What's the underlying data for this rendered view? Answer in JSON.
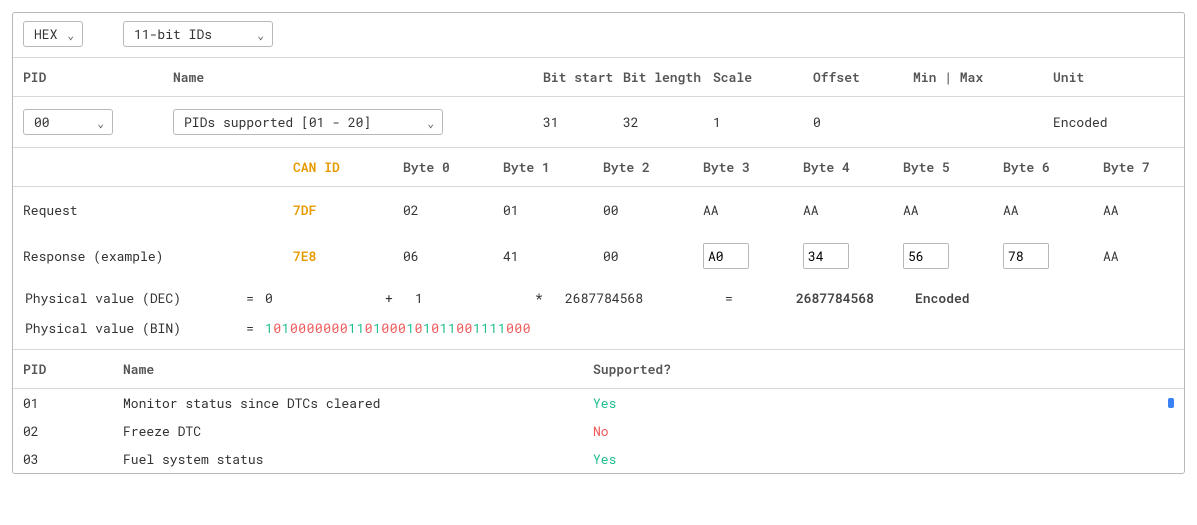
{
  "controls": {
    "format": "HEX",
    "id_width": "11-bit IDs"
  },
  "columns_top": {
    "pid": "PID",
    "name": "Name",
    "bit_start": "Bit start",
    "bit_length": "Bit length",
    "scale": "Scale",
    "offset": "Offset",
    "min_max": "Min | Max",
    "unit": "Unit"
  },
  "selected": {
    "pid": "00",
    "name": "PIDs supported [01 - 20]",
    "bit_start": "31",
    "bit_length": "32",
    "scale": "1",
    "offset": "0",
    "min_max": "",
    "unit": "Encoded"
  },
  "byte_headers": {
    "can_id": "CAN ID",
    "b0": "Byte 0",
    "b1": "Byte 1",
    "b2": "Byte 2",
    "b3": "Byte 3",
    "b4": "Byte 4",
    "b5": "Byte 5",
    "b6": "Byte 6",
    "b7": "Byte 7"
  },
  "request": {
    "label": "Request",
    "can_id": "7DF",
    "bytes": [
      "02",
      "01",
      "00",
      "AA",
      "AA",
      "AA",
      "AA",
      "AA"
    ]
  },
  "response": {
    "label": "Response (example)",
    "can_id": "7E8",
    "fixed": [
      "06",
      "41",
      "00"
    ],
    "inputs": [
      "A0",
      "34",
      "56",
      "78"
    ],
    "tail": "AA"
  },
  "physical_dec": {
    "label": "Physical value (DEC)",
    "offset": "0",
    "plus": "+",
    "scale": "1",
    "times": "*",
    "raw": "2687784568",
    "eq2": "=",
    "result": "2687784568",
    "unit": "Encoded"
  },
  "physical_bin": {
    "label": "Physical value (BIN)",
    "bits": "10100000001101000101011001111000"
  },
  "support": {
    "headers": {
      "pid": "PID",
      "name": "Name",
      "supported": "Supported?"
    },
    "rows": [
      {
        "pid": "01",
        "name": "Monitor status since DTCs cleared",
        "supported": "Yes"
      },
      {
        "pid": "02",
        "name": "Freeze DTC",
        "supported": "No"
      },
      {
        "pid": "03",
        "name": "Fuel system status",
        "supported": "Yes"
      }
    ]
  }
}
